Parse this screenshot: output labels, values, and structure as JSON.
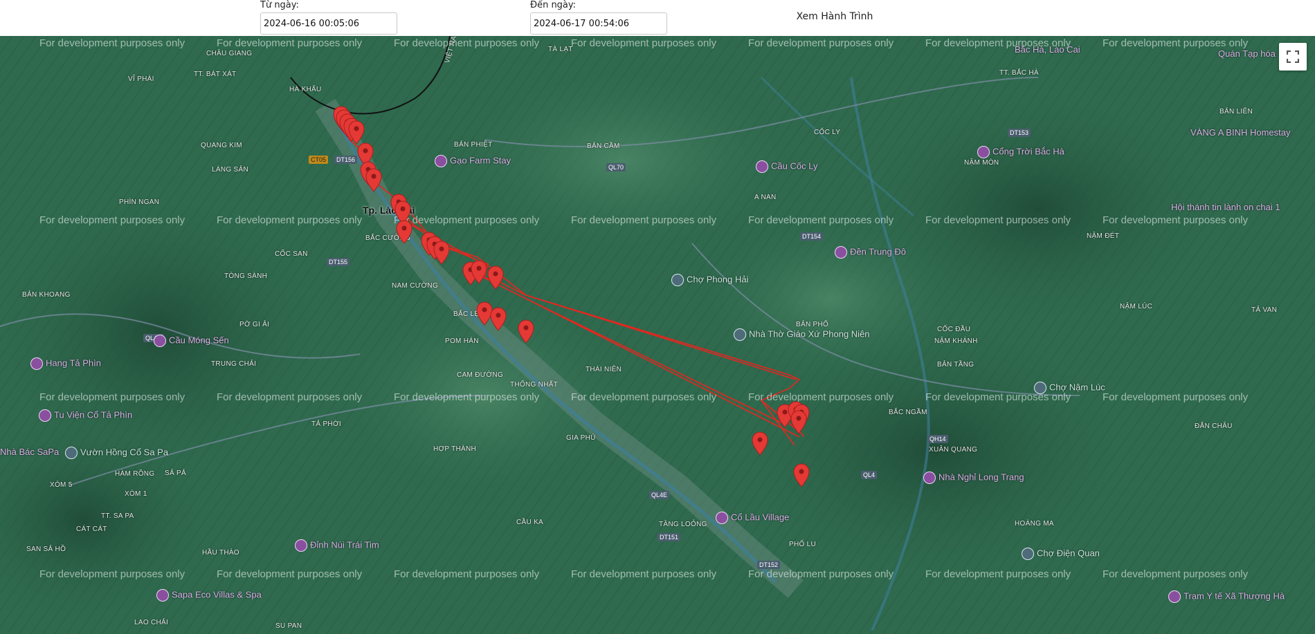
{
  "filters": {
    "from_label": "Từ ngày:",
    "from_value": "2024-06-16 00:05:06",
    "to_label": "Đến ngày:",
    "to_value": "2024-06-17 00:54:06",
    "view_button": "Xem Hành Trình"
  },
  "map": {
    "watermark": "For development purposes only",
    "fullscreen_icon": "fullscreen-icon",
    "route_color": "#e8251f",
    "marker_color": "#e53935",
    "city_label": "Tp. Lào Cai",
    "places": [
      "VIỆT NAM",
      "CHÂU GIANG",
      "TÀ LẠT",
      "VĨ PHÁI",
      "TT. BÁT XÁT",
      "HÀ KHẨU",
      "BẢN PHIỆT",
      "BẢN CẦM",
      "QUANG KIM",
      "LÀNG SẢN",
      "PHÌN NGAN",
      "CỐC SAN",
      "TÒNG SÀNH",
      "BẢN KHOANG",
      "PỜ GI ẢI",
      "TRUNG CHẢI",
      "BẮC CƯỜNG",
      "NAM CƯỜNG",
      "BẮC LỆNH",
      "POM HÁN",
      "CAM ĐƯỜNG",
      "THỐNG NHẤT",
      "THÁI NIÊN",
      "GIA PHÚ",
      "HỢP THÀNH",
      "TẢ PHỜI",
      "XÓM 5",
      "XÓM 1",
      "HÀM RỒNG",
      "SẢ PẢ",
      "TT. SA PA",
      "CÁT CÁT",
      "SAN SẢ HỒ",
      "HẦU THÀO",
      "LAO CHẢI",
      "SU PAN",
      "CẦU KA",
      "TĂNG LOỎNG",
      "PHỐ LU",
      "HOÀNG MA",
      "CỐC LY",
      "A NAN",
      "BẢN PHỐ",
      "TT. BẮC HÀ",
      "BẢN LIÊN",
      "NẬM MÒN",
      "NẬM ĐÉT",
      "NẬM LÚC",
      "CỐC ĐẦU",
      "NẬM KHÁNH",
      "BẢN TẦNG",
      "BẮC NGẦM",
      "XUÂN QUANG",
      "ĐẮN CHÂU",
      "TẢ VAN"
    ],
    "pois": [
      "Gạo Farm Stay",
      "Cầu Cốc Ly",
      "Cổng Trời Bắc Hà",
      "Đền Trung Đô",
      "Chợ Phong Hải",
      "Nhà Thờ Giáo Xứ Phong Niên",
      "Cầu Móng Sến",
      "Hang Tả Phìn",
      "Tu Viện Cổ Tả Phìn",
      "Vườn Hồng Cổ Sa Pa",
      "Nhà Bác SaPa",
      "Đỉnh Núi Trái Tim",
      "Sapa Eco Villas & Spa",
      "Cổ Lầu Village",
      "Chợ Nậm Lúc",
      "Nhà Nghỉ Long Trang",
      "Chợ Điện Quan",
      "Trạm Y tế Xã Thượng Hà",
      "VÀNG A BINH Homestay",
      "Hội thánh tin lành on chai 1",
      "Quán Tạp hóa",
      "Bắc Hà, Lào Cai"
    ],
    "roads": [
      "QL4D",
      "CT05",
      "DT156",
      "QL70",
      "DT153",
      "DT154",
      "DT155",
      "QL4E",
      "QH14",
      "DT151",
      "DT152",
      "QL4"
    ]
  }
}
